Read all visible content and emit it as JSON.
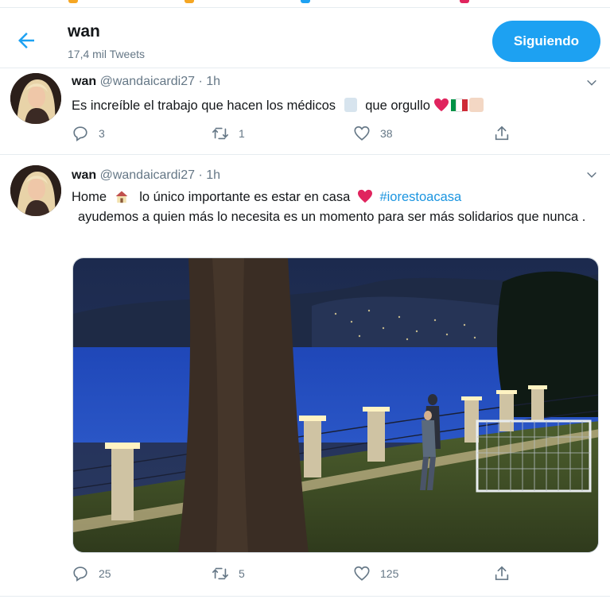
{
  "colors": {
    "accent": "#1da1f2",
    "muted": "#657786",
    "text": "#14171a",
    "like_red": "#e0245e"
  },
  "header": {
    "name": "wan",
    "tweet_count": "17,4 mil Tweets",
    "follow_label": "Siguiendo"
  },
  "tweets": [
    {
      "name": "wan",
      "handle": "@wandaicardi27",
      "separator": "·",
      "time": "1h",
      "text_part1": "Es increíble el trabajo que hacen los médicos",
      "text_part2": "que orgullo",
      "replies": "3",
      "retweets": "1",
      "likes": "38"
    },
    {
      "name": "wan",
      "handle": "@wandaicardi27",
      "separator": "·",
      "time": "1h",
      "text_part1": "Home",
      "text_part2": "lo único importante es estar en casa",
      "hashtag": "#iorestoacasa",
      "text_part3": "ayudemos a quien más lo necesita es un momento para ser más solidarios que nunca .",
      "replies": "25",
      "retweets": "5",
      "likes": "125"
    }
  ],
  "icons": [
    "back-arrow-icon",
    "chevron-down-icon",
    "reply-icon",
    "retweet-icon",
    "like-icon",
    "share-icon",
    "heart-emoji-icon",
    "italy-flag-icon",
    "praying-hands-icon",
    "doctor-emoji-icon",
    "house-emoji-icon"
  ]
}
